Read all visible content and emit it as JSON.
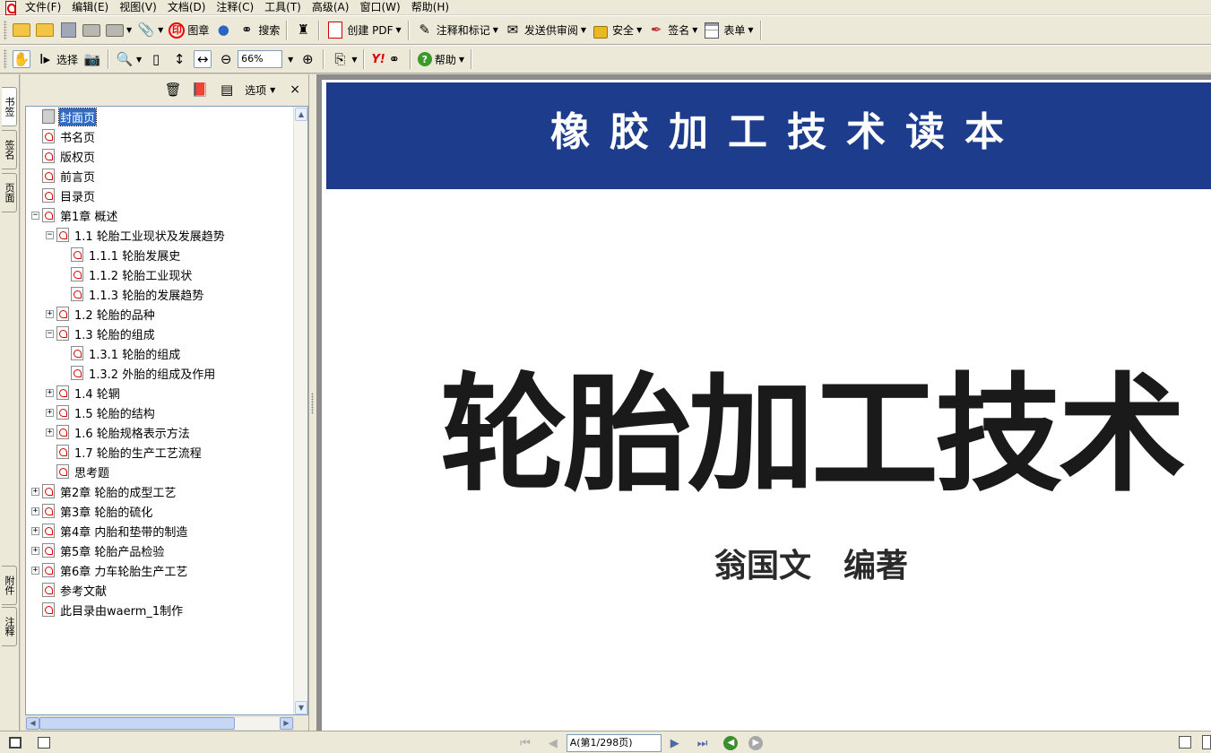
{
  "menubar": {
    "items": [
      "文件(F)",
      "编辑(E)",
      "视图(V)",
      "文档(D)",
      "注释(C)",
      "工具(T)",
      "高级(A)",
      "窗口(W)",
      "帮助(H)"
    ]
  },
  "toolbar1": {
    "seal_label": "图章",
    "search_label": "搜索",
    "create_pdf_label": "创建 PDF",
    "comment_label": "注释和标记",
    "review_label": "发送供审阅",
    "security_label": "安全",
    "sign_label": "签名",
    "form_label": "表单"
  },
  "toolbar2": {
    "select_label": "选择",
    "zoom_value": "66%",
    "help_label": "帮助",
    "yahoo_label": "Y!"
  },
  "side_tabs": [
    "书签",
    "签名",
    "页面",
    "附件",
    "注释"
  ],
  "bookmarks_panel": {
    "options_label": "选项",
    "close_label": "×",
    "items": [
      {
        "label": "封面页",
        "level": 0,
        "expander": "",
        "selected": true,
        "icon": "page-icon"
      },
      {
        "label": "书名页",
        "level": 0,
        "expander": "",
        "selected": false,
        "icon": "pdf-bookmark-icon"
      },
      {
        "label": "版权页",
        "level": 0,
        "expander": "",
        "selected": false,
        "icon": "pdf-bookmark-icon"
      },
      {
        "label": "前言页",
        "level": 0,
        "expander": "",
        "selected": false,
        "icon": "pdf-bookmark-icon"
      },
      {
        "label": "目录页",
        "level": 0,
        "expander": "",
        "selected": false,
        "icon": "pdf-bookmark-icon"
      },
      {
        "label": "第1章 概述",
        "level": 0,
        "expander": "−",
        "selected": false,
        "icon": "pdf-bookmark-icon"
      },
      {
        "label": "1.1 轮胎工业现状及发展趋势",
        "level": 1,
        "expander": "−",
        "selected": false,
        "icon": "pdf-bookmark-icon"
      },
      {
        "label": "1.1.1 轮胎发展史",
        "level": 2,
        "expander": "",
        "selected": false,
        "icon": "pdf-bookmark-icon"
      },
      {
        "label": "1.1.2 轮胎工业现状",
        "level": 2,
        "expander": "",
        "selected": false,
        "icon": "pdf-bookmark-icon"
      },
      {
        "label": "1.1.3 轮胎的发展趋势",
        "level": 2,
        "expander": "",
        "selected": false,
        "icon": "pdf-bookmark-icon"
      },
      {
        "label": "1.2 轮胎的品种",
        "level": 1,
        "expander": "+",
        "selected": false,
        "icon": "pdf-bookmark-icon"
      },
      {
        "label": "1.3 轮胎的组成",
        "level": 1,
        "expander": "−",
        "selected": false,
        "icon": "pdf-bookmark-icon"
      },
      {
        "label": "1.3.1 轮胎的组成",
        "level": 2,
        "expander": "",
        "selected": false,
        "icon": "pdf-bookmark-icon"
      },
      {
        "label": "1.3.2 外胎的组成及作用",
        "level": 2,
        "expander": "",
        "selected": false,
        "icon": "pdf-bookmark-icon"
      },
      {
        "label": "1.4 轮辋",
        "level": 1,
        "expander": "+",
        "selected": false,
        "icon": "pdf-bookmark-icon"
      },
      {
        "label": "1.5 轮胎的结构",
        "level": 1,
        "expander": "+",
        "selected": false,
        "icon": "pdf-bookmark-icon"
      },
      {
        "label": "1.6 轮胎规格表示方法",
        "level": 1,
        "expander": "+",
        "selected": false,
        "icon": "pdf-bookmark-icon"
      },
      {
        "label": "1.7 轮胎的生产工艺流程",
        "level": 1,
        "expander": "",
        "selected": false,
        "icon": "pdf-bookmark-icon"
      },
      {
        "label": "思考题",
        "level": 1,
        "expander": "",
        "selected": false,
        "icon": "pdf-bookmark-icon"
      },
      {
        "label": "第2章 轮胎的成型工艺",
        "level": 0,
        "expander": "+",
        "selected": false,
        "icon": "pdf-bookmark-icon"
      },
      {
        "label": "第3章 轮胎的硫化",
        "level": 0,
        "expander": "+",
        "selected": false,
        "icon": "pdf-bookmark-icon"
      },
      {
        "label": "第4章 内胎和垫带的制造",
        "level": 0,
        "expander": "+",
        "selected": false,
        "icon": "pdf-bookmark-icon"
      },
      {
        "label": "第5章 轮胎产品检验",
        "level": 0,
        "expander": "+",
        "selected": false,
        "icon": "pdf-bookmark-icon"
      },
      {
        "label": "第6章 力车轮胎生产工艺",
        "level": 0,
        "expander": "+",
        "selected": false,
        "icon": "pdf-bookmark-icon"
      },
      {
        "label": "参考文献",
        "level": 0,
        "expander": "",
        "selected": false,
        "icon": "pdf-bookmark-icon"
      },
      {
        "label": "此目录由waerm_1制作",
        "level": 0,
        "expander": "",
        "selected": false,
        "icon": "pdf-bookmark-icon"
      }
    ]
  },
  "document": {
    "banner_text": "橡胶加工技术读本",
    "title": "轮胎加工技术",
    "author": "翁国文　编著",
    "banner_color": "#1d3d8c"
  },
  "statusbar": {
    "page_indicator": "A(第1/298页)"
  }
}
